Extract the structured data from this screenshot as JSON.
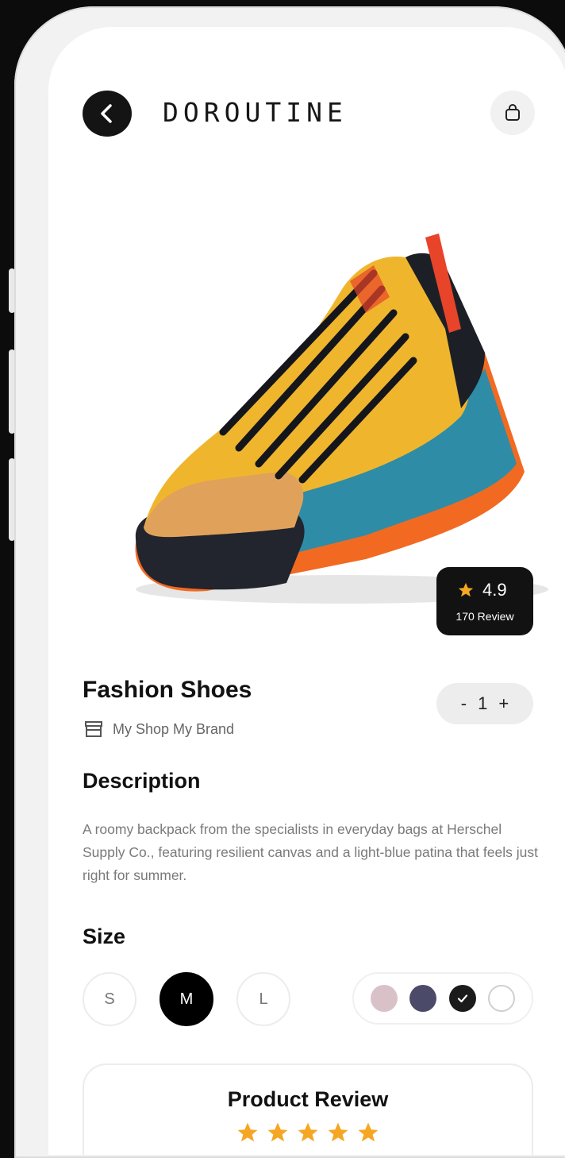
{
  "header": {
    "brand": "DOROUTINE"
  },
  "rating": {
    "value": "4.9",
    "count_label": "170 Review"
  },
  "product": {
    "name": "Fashion Shoes",
    "shop": "My Shop My Brand"
  },
  "quantity": {
    "minus": "-",
    "value": "1",
    "plus": "+"
  },
  "description": {
    "title": "Description",
    "text": "A roomy backpack from the specialists in everyday bags at Herschel Supply Co., featuring resilient canvas and a light-blue patina that feels just right for summer."
  },
  "size": {
    "title": "Size",
    "options": [
      "S",
      "M",
      "L"
    ],
    "selected": "M"
  },
  "colors": {
    "options": [
      {
        "name": "pink",
        "hex": "#d8c2c7"
      },
      {
        "name": "slate",
        "hex": "#4b4a68"
      },
      {
        "name": "black",
        "hex": "#1b1b1b"
      },
      {
        "name": "white",
        "hex": "#ffffff"
      }
    ],
    "selected": "black"
  },
  "review": {
    "title": "Product Review",
    "stars": 5
  },
  "theme": {
    "accent": "#f5a623",
    "dark": "#121212"
  }
}
